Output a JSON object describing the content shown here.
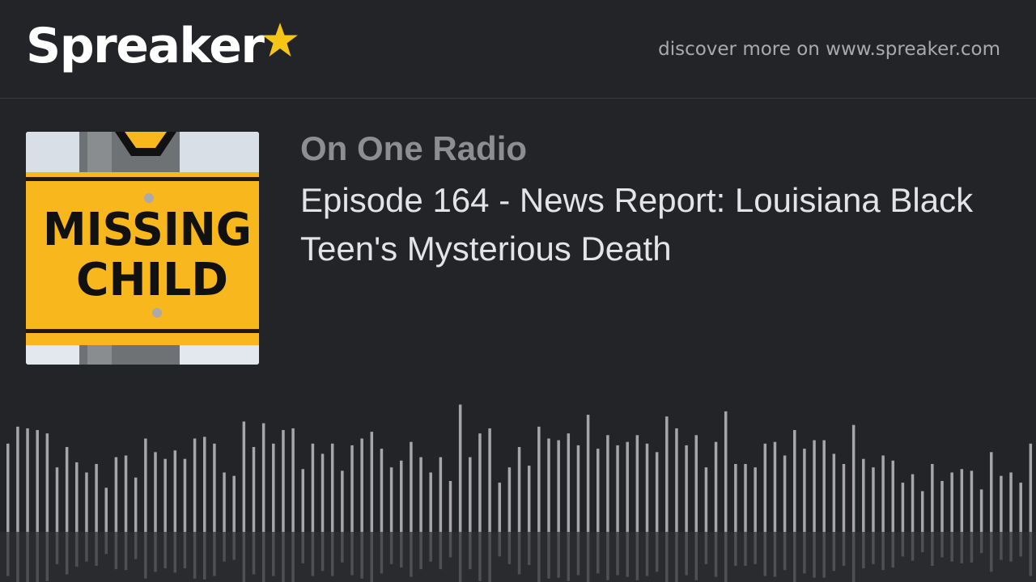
{
  "header": {
    "logo_text": "Spreaker",
    "logo_star_color": "#f5c518",
    "discover_text": "discover more on www.spreaker.com"
  },
  "cover": {
    "sign_color": "#f8b71c",
    "line1": "MISSING",
    "line2": "CHILD"
  },
  "podcast": {
    "show_title": "On One Radio",
    "episode_title": "Episode 164 - News Report: Louisiana Black Teen's Mysterious Death"
  },
  "waveform": {
    "bar_color": "#a6a6a8",
    "levels": [
      0.52,
      0.62,
      0.61,
      0.6,
      0.58,
      0.38,
      0.5,
      0.41,
      0.35,
      0.4,
      0.26,
      0.44,
      0.45,
      0.32,
      0.55,
      0.47,
      0.43,
      0.48,
      0.43,
      0.55,
      0.56,
      0.52,
      0.35,
      0.33,
      0.65,
      0.5,
      0.64,
      0.52,
      0.6,
      0.61,
      0.37,
      0.52,
      0.46,
      0.52,
      0.36,
      0.51,
      0.55,
      0.59,
      0.49,
      0.38,
      0.42,
      0.53,
      0.44,
      0.35,
      0.44,
      0.3,
      0.75,
      0.44,
      0.58,
      0.61,
      0.29,
      0.38,
      0.5,
      0.39,
      0.62,
      0.55,
      0.54,
      0.58,
      0.51,
      0.69,
      0.49,
      0.57,
      0.51,
      0.53,
      0.57,
      0.52,
      0.47,
      0.68,
      0.61,
      0.51,
      0.57,
      0.38,
      0.53,
      0.71,
      0.4,
      0.4,
      0.38,
      0.52,
      0.53,
      0.45,
      0.6,
      0.49,
      0.54,
      0.54,
      0.46,
      0.4,
      0.63,
      0.43,
      0.38,
      0.45,
      0.42,
      0.29,
      0.34,
      0.24,
      0.4,
      0.3,
      0.35,
      0.37,
      0.36,
      0.25,
      0.47,
      0.33,
      0.35,
      0.29,
      0.52,
      0.58,
      0.48,
      0.68,
      0.55
    ]
  }
}
